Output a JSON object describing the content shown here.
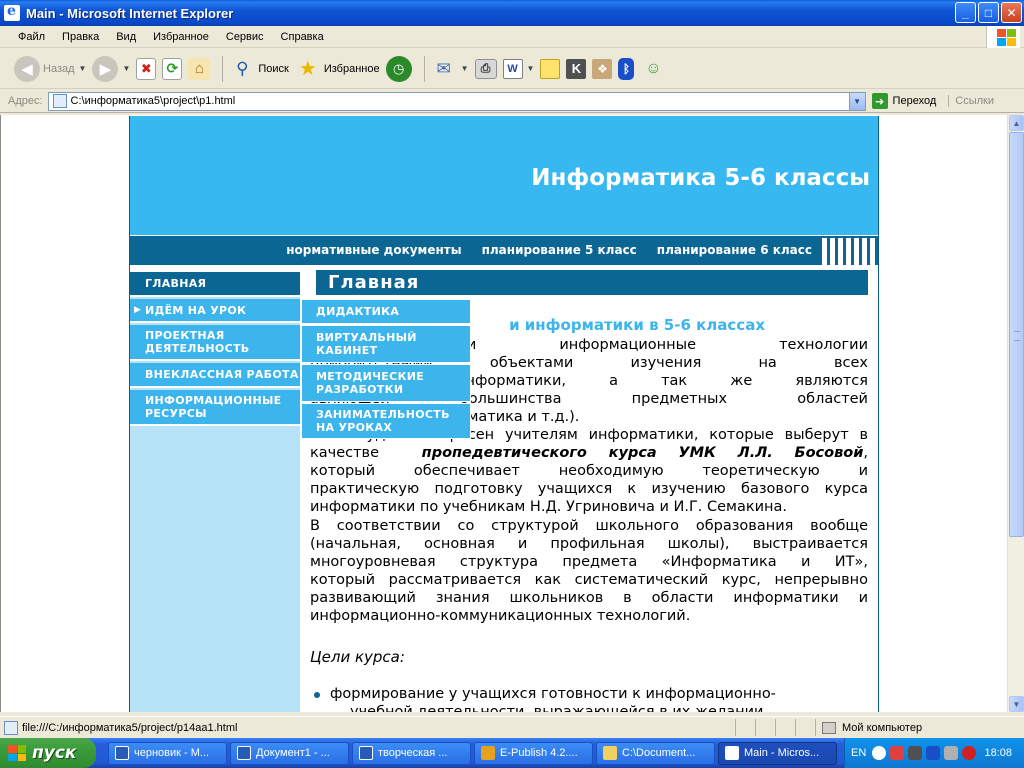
{
  "window": {
    "title": "Main - Microsoft Internet Explorer",
    "buttons": {
      "minimize": "_",
      "maximize": "□",
      "close": "✕"
    }
  },
  "menubar": [
    "Файл",
    "Правка",
    "Вид",
    "Избранное",
    "Сервис",
    "Справка"
  ],
  "toolbar": {
    "back": "Назад",
    "search": "Поиск",
    "favorites": "Избранное"
  },
  "address": {
    "label": "Адрес:",
    "value": "C:\\информатика5\\project\\p1.html",
    "go": "Переход",
    "links": "Ссылки"
  },
  "site": {
    "title": "Информатика 5-6 классы",
    "topnav": [
      "нормативные документы",
      "планирование 5 класс",
      "планирование 6 класс"
    ],
    "sidebar": [
      {
        "label": "ГЛАВНАЯ",
        "active": true
      },
      {
        "label": "ИДЁМ НА УРОК",
        "arrow": "▶"
      },
      {
        "label": "ПРОЕКТНАЯ ДЕЯТЕЛЬНОСТЬ"
      },
      {
        "label": "ВНЕКЛАССНАЯ РАБОТА"
      },
      {
        "label": "ИНФОРМАЦИОННЫЕ РЕСУРСЫ"
      }
    ],
    "submenu": [
      "ДИДАКТИКА",
      "ВИРТУАЛЬНЫЙ КАБИНЕТ",
      "МЕТОДИЧЕСКИЕ РАЗРАБОТКИ",
      "ЗАНИМАТЕЛЬНОСТЬ НА УРОКАХ"
    ],
    "content": {
      "heading": "Главная",
      "subheading": "и информатики в 5-6 классах",
      "para1_lines": [
        "процессы и информационные технологии",
        "приоритетными объектами изучения на всех",
        "го курса информатики, а так же являются",
        "авляющей большинства предметных областей",
        "вание, физика, математика и т.д.)."
      ],
      "para2_line1_pre": "Сайт будет интересен учителям информатики, которые выберут в",
      "para2_line2_pre": "качестве",
      "para2_line2_em": "пропедевтического курса УМК Л.Л. Босовой",
      "para2_line2_post": ",",
      "para2_lines": [
        "который обеспечивает необходимую теоретическую и",
        "практическую подготовку учащихся к изучению базового курса",
        "информатики по учебникам Н.Д. Угриновича и И.Г. Семакина."
      ],
      "para3_lines": [
        "В соответствии со структурой школьного образования вообще",
        "(начальная, основная и профильная школы), выстраивается",
        "многоуровневая структура предмета «Информатика и ИТ»,",
        "который рассматривается как систематический курс, непрерывно",
        "развивающий знания школьников в области информатики и",
        "информационно-коммуникационных технологий."
      ],
      "goals_title": "Цели курса:",
      "bullet1": "формирование у учащихся готовности к информационно-",
      "bullet1_cont": "учебной деятельности, выражающейся в их желании"
    }
  },
  "statusbar": {
    "text": "file:///C:/информатика5/project/p14aa1.html",
    "zone": "Мой компьютер"
  },
  "taskbar": {
    "start": "пуск",
    "tasks": [
      "черновик - М...",
      "Документ1 - ...",
      "творческая ...",
      "E-Publish 4.2....",
      "C:\\Document...",
      "Main - Micros..."
    ],
    "lang": "EN",
    "clock": "18:08"
  }
}
